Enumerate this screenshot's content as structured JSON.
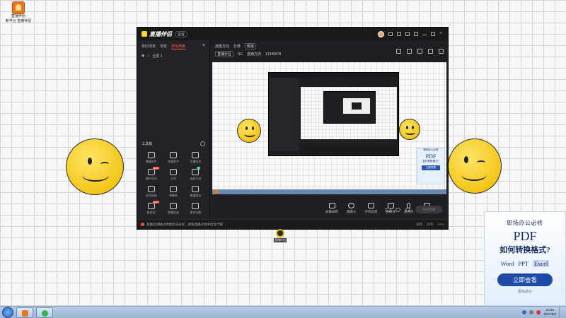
{
  "desktop_icon": {
    "label": "直播伴侣",
    "sublabel": "新平台 直播伴侣"
  },
  "app": {
    "title": "直播伴侣",
    "version_badge": "企业",
    "scene_tabs": [
      "我的场景",
      "场景",
      "添加场景"
    ],
    "scene_row": {
      "label": "全屏 1"
    },
    "tools_header": "工具箱",
    "tools": [
      {
        "label": "弹幕助手",
        "tag": ""
      },
      {
        "label": "房管助手",
        "tag": ""
      },
      {
        "label": "主播任务",
        "tag": ""
      },
      {
        "label": "福利活动",
        "tag": "NEW"
      },
      {
        "label": "分享",
        "tag": ""
      },
      {
        "label": "连麦互动",
        "tag": "新"
      },
      {
        "label": "远程协助",
        "tag": ""
      },
      {
        "label": "弹幕库",
        "tag": ""
      },
      {
        "label": "数据报告",
        "tag": ""
      },
      {
        "label": "粉丝团",
        "tag": "NEW"
      },
      {
        "label": "直播回放",
        "tag": ""
      },
      {
        "label": "更多功能",
        "tag": ""
      }
    ],
    "subbar": {
      "row1": [
        "选题方向",
        "分类",
        "频道"
      ],
      "row2": [
        "直播分区",
        "SC",
        "直播方向",
        "12345678"
      ]
    },
    "controls": [
      {
        "name": "screen-share",
        "label": "屏幕录制"
      },
      {
        "name": "camera",
        "label": "摄像头"
      },
      {
        "name": "phone-projection",
        "label": "手机投屏"
      },
      {
        "name": "play-media",
        "label": "多媒体"
      },
      {
        "name": "microphone",
        "label": "麦克风"
      },
      {
        "name": "speaker",
        "label": "扬声器"
      }
    ],
    "go_live": "开始直播",
    "status": {
      "notice": "直播前请确认网络状况良好，避免直播过程中出现卡顿",
      "right": [
        "帧率",
        "码率",
        "CPU"
      ]
    }
  },
  "floating_icon": {
    "label": "直播伴侣"
  },
  "mini_promo": {
    "top": "职场办公必修",
    "big": "PDF",
    "sub": "如何转换格式?",
    "btn": "立即查看"
  },
  "promo": {
    "top": "职场办公必修",
    "big": "PDF",
    "sub": "如何转换格式?",
    "formats": [
      "Word",
      "PPT",
      "Excel"
    ],
    "button": "立即查看",
    "footer": "雷鸟办公"
  },
  "taskbar": {
    "time": "10:33",
    "date": "2021/6/4"
  }
}
